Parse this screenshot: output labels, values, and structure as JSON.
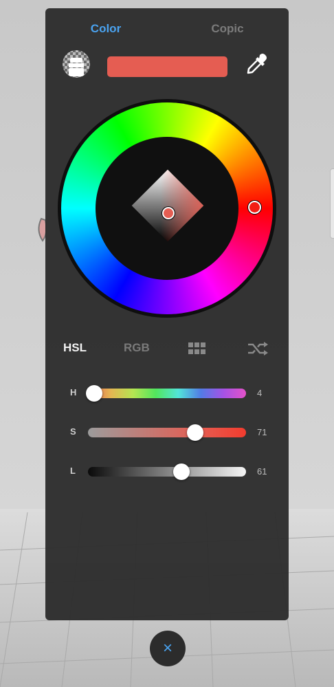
{
  "tabs": [
    {
      "label": "Color",
      "active": true
    },
    {
      "label": "Copic",
      "active": false
    }
  ],
  "current_color": "#e55d52",
  "icons": {
    "swatch": "transparent-swatch-icon",
    "eyedropper": "eyedropper-icon",
    "grid": "grid-icon",
    "shuffle": "shuffle-icon",
    "close": "close-icon"
  },
  "modes": [
    {
      "label": "HSL",
      "active": true
    },
    {
      "label": "RGB",
      "active": false
    }
  ],
  "sliders": {
    "h": {
      "label": "H",
      "value": "4",
      "fraction": 0.04
    },
    "s": {
      "label": "S",
      "value": "71",
      "fraction": 0.68
    },
    "l": {
      "label": "L",
      "value": "61",
      "fraction": 0.59
    }
  },
  "close_label": "×",
  "accent_color": "#4aa3f0"
}
